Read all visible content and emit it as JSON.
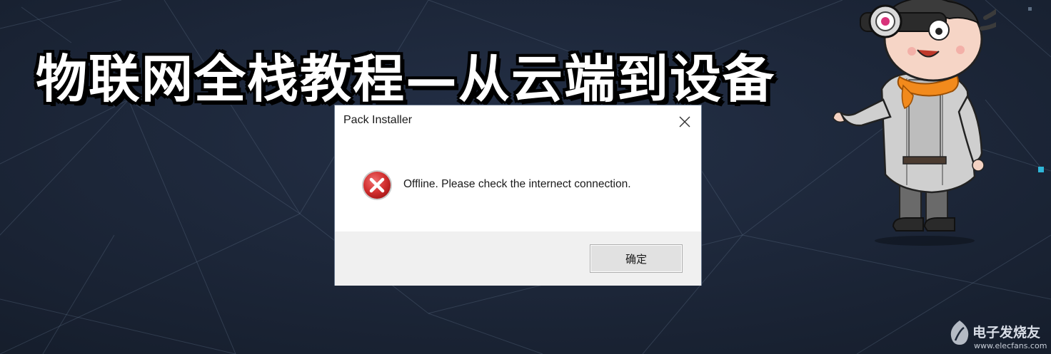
{
  "banner": {
    "title": "物联网全栈教程—从云端到设备"
  },
  "dialog": {
    "title": "Pack Installer",
    "message": "Offline. Please check the internect connection.",
    "ok_label": "确定"
  },
  "watermark": {
    "name": "电子发烧友",
    "url": "www.elecfans.com"
  },
  "icons": {
    "close": "close-icon",
    "error": "error-icon",
    "watermark_logo": "elecfans-logo-icon"
  },
  "colors": {
    "background": "#1b2536",
    "error_red": "#d22f2f",
    "dialog_footer": "#f0f0f0"
  }
}
